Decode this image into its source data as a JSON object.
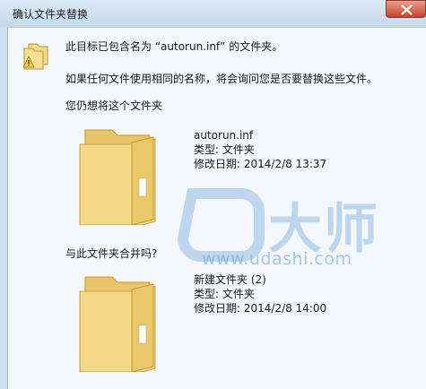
{
  "window": {
    "title": "确认文件夹替换"
  },
  "dialog": {
    "message": "此目标已包含名为 “autorun.inf” 的文件夹。",
    "line2": "如果任何文件使用相同的名称，将会询问您是否要替换这些文件。",
    "line3": "您仍想将这个文件夹",
    "merge_question": "与此文件夹合并吗?"
  },
  "target_folder": {
    "name": "autorun.inf",
    "type": "类型: 文件夹",
    "modified": "修改日期: 2014/2/8 13:37"
  },
  "source_folder": {
    "name": "新建文件夹 (2)",
    "type": "类型: 文件夹",
    "modified": "修改日期: 2014/2/8 14:00"
  },
  "watermark": {
    "logo_text": "大师",
    "url": "www.udashi.com"
  },
  "icons": [
    "warning-folder-icon",
    "folder-icon",
    "close-icon"
  ],
  "colors": {
    "accent": "#5d9bd6",
    "folder": "#f2d27a"
  }
}
